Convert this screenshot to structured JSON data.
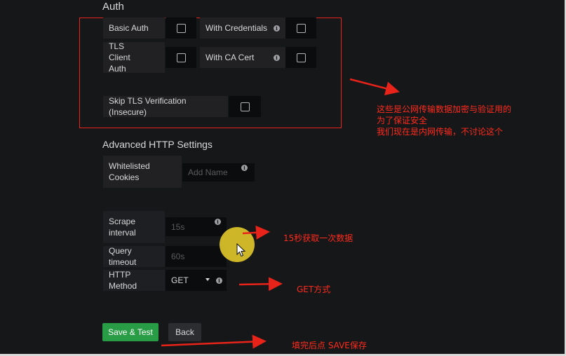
{
  "auth": {
    "title": "Auth",
    "basic_auth": "Basic Auth",
    "with_credentials": "With Credentials",
    "tls_client_auth": "TLS Client Auth",
    "with_ca_cert": "With CA Cert",
    "skip_tls": "Skip TLS Verification (Insecure)"
  },
  "advanced": {
    "title": "Advanced HTTP Settings",
    "whitelisted_cookies": "Whitelisted Cookies",
    "cookies_placeholder": "Add Name"
  },
  "prometheus": {
    "scrape_interval_label": "Scrape interval",
    "scrape_interval_placeholder": "15s",
    "query_timeout_label": "Query timeout",
    "query_timeout_placeholder": "60s",
    "http_method_label": "HTTP Method",
    "http_method_value": "GET"
  },
  "buttons": {
    "save_test": "Save & Test",
    "back": "Back"
  },
  "annotations": {
    "tls_note_line1": "这些是公网传输数据加密与验证用的",
    "tls_note_line2": "为了保证安全",
    "tls_note_line3": "我们现在是内网传输，不讨论这个",
    "scrape_note": "15秒获取一次数据",
    "method_note": "GET方式",
    "save_note": "填完后点 SAVE保存"
  },
  "icons": {
    "info": "info-icon",
    "dropdown": "caret-down-icon",
    "cursor": "mouse-pointer-icon"
  },
  "colors": {
    "background": "#161719",
    "panel_label": "#212124",
    "input_bg": "#0b0c0e",
    "save_button": "#299c46",
    "annotation_red": "#ff2b1c",
    "cursor_highlight": "#ddc428"
  }
}
